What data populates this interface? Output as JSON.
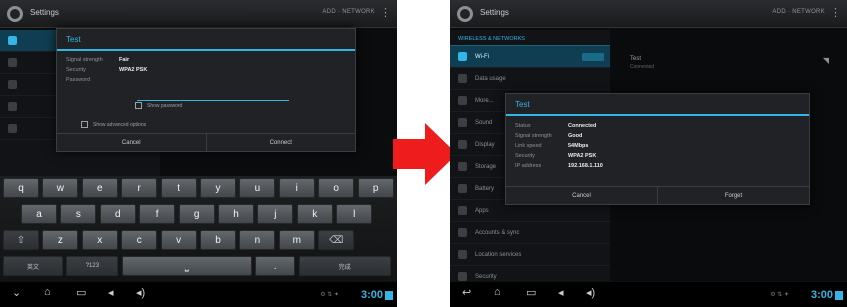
{
  "left_screen": {
    "actionbar": {
      "title": "Settings",
      "right_text": "ADD · NETWORK",
      "menu_icon": "overflow-icon"
    },
    "dialog": {
      "title": "Test",
      "rows": [
        {
          "key": "Signal strength",
          "value": "Fair"
        },
        {
          "key": "Security",
          "value": "WPA2 PSK"
        },
        {
          "key": "Password",
          "value": ""
        }
      ],
      "show_password_label": "Show password",
      "advanced_label": "Show advanced options",
      "buttons": [
        "Cancel",
        "Connect"
      ]
    },
    "keyboard": {
      "row1": [
        "q",
        "w",
        "e",
        "r",
        "t",
        "y",
        "u",
        "i",
        "o",
        "p"
      ],
      "row2": [
        "a",
        "s",
        "d",
        "f",
        "g",
        "h",
        "j",
        "k",
        "l"
      ],
      "row3": [
        "⇧",
        "z",
        "x",
        "c",
        "v",
        "b",
        "n",
        "m",
        "⌫"
      ],
      "row4": [
        "英文",
        "?123",
        "⎵",
        ".",
        "完成"
      ]
    },
    "status_clock": "3:00"
  },
  "right_screen": {
    "actionbar": {
      "title": "Settings",
      "right_text": "ADD · NETWORK",
      "menu_icon": "overflow-icon"
    },
    "settings_header": "WIRELESS & NETWORKS",
    "settings_items": [
      "Wi-Fi",
      "Data usage",
      "More...",
      "Sound",
      "Display",
      "Storage",
      "Battery",
      "Apps",
      "Accounts & sync",
      "Location services",
      "Security"
    ],
    "network_name": "Test",
    "network_status": "Connected",
    "dialog": {
      "title": "Test",
      "rows": [
        {
          "key": "Status",
          "value": "Connected"
        },
        {
          "key": "Signal strength",
          "value": "Good"
        },
        {
          "key": "Link speed",
          "value": "54Mbps"
        },
        {
          "key": "Security",
          "value": "WPA2 PSK"
        },
        {
          "key": "IP address",
          "value": "192.168.1.110"
        }
      ],
      "buttons": [
        "Cancel",
        "Forget"
      ]
    },
    "status_clock": "3:00"
  },
  "colors": {
    "accent": "#33b5e5",
    "arrow": "#ee1c1c",
    "background": "#0b0c0e"
  }
}
